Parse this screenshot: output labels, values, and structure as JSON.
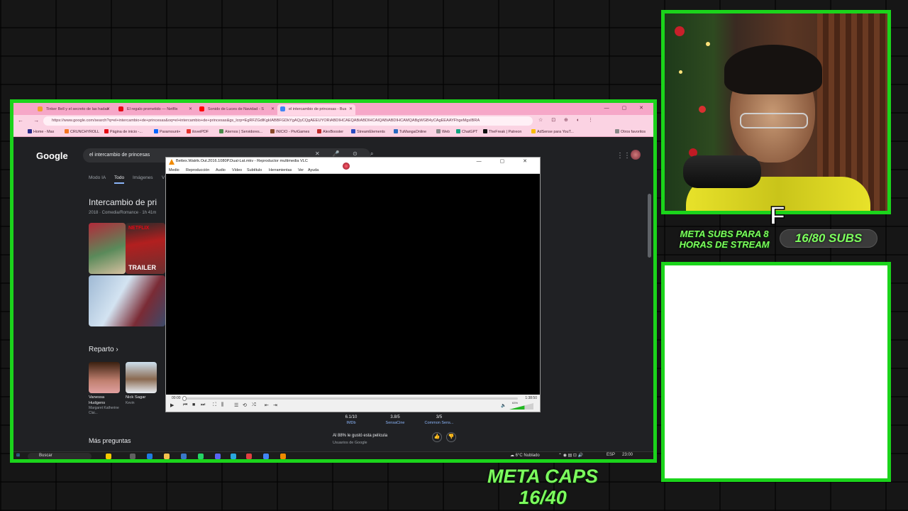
{
  "browser": {
    "tabs": [
      {
        "label": "Tinker Bell y el secreto de las hadas",
        "color": "#f0a030"
      },
      {
        "label": "El regalo prometido — Netflix",
        "color": "#e50914"
      },
      {
        "label": "Sonido de Luces de Navidad - S",
        "color": "#ff0000"
      },
      {
        "label": "el intercambio de princesas - Bus",
        "color": "#4285f4"
      }
    ],
    "url": "https://www.google.com/search?q=el+intercambio+de+princesas&oq=el+intercambio+de+princesas&gs_lcrp=EgRFZGdlKgkIABBFGDkYgAQyCQgAEEUYORiABDIHCAEQABiABDIHCAIQABiABDIHCAMQABgWGB4yCAgEEAAYFhgeMgsIBRA",
    "bookmarks": [
      {
        "label": "Home - Max",
        "color": "#2a2a8a"
      },
      {
        "label": "CRUNCHYROLL",
        "color": "#f47521"
      },
      {
        "label": "Página de inicio -...",
        "color": "#e50914"
      },
      {
        "label": "Paramount+",
        "color": "#0064ff"
      },
      {
        "label": "iloveiPDF",
        "color": "#e5322d"
      },
      {
        "label": "Aternos | Servidores...",
        "color": "#4a8a4a"
      },
      {
        "label": "INICIO - PiviGames",
        "color": "#8a4a2a"
      },
      {
        "label": "AlexBooster",
        "color": "#c02a2a"
      },
      {
        "label": "StreamElements",
        "color": "#2a4ac0"
      },
      {
        "label": "TuMangaOnline",
        "color": "#2a6ac0"
      },
      {
        "label": "Web",
        "color": "#888888"
      },
      {
        "label": "ChatGPT",
        "color": "#10a37f"
      },
      {
        "label": "TheFreak | Patreon",
        "color": "#111111"
      },
      {
        "label": "AdSense para YouT...",
        "color": "#fbbc04"
      },
      {
        "label": "Otros favoritos",
        "color": "#888888"
      }
    ]
  },
  "google": {
    "logo": "Google",
    "query": "el intercambio de princesas",
    "tabs": [
      "Modo IA",
      "Todo",
      "Imágenes",
      "V"
    ],
    "result_title": "Intercambio de pri",
    "result_meta": "2018 · Comedia/Romance · 1h 41m",
    "poster_labels": {
      "netflix": "NETFLIX",
      "trailer": "TRAILER"
    },
    "cast_heading": "Reparto",
    "cast": [
      {
        "name": "Vanessa Hudgens",
        "role": "Margaret Katherine Clai..."
      },
      {
        "name": "Nick Sagar",
        "role": "Kevin"
      }
    ],
    "ratings": [
      {
        "value": "6.1/10",
        "source": "IMDb"
      },
      {
        "value": "3.8/5",
        "source": "SensaCine"
      },
      {
        "value": "3/5",
        "source": "Common Sens..."
      }
    ],
    "liked": "Al 88% le gustó esta película",
    "users": "Usuarios de Google",
    "more_questions": "Más preguntas"
  },
  "vlc": {
    "title": "Bettex.Watrik.Out.2016.1080P.Dual-Lat.mkv - Reproductor multimedia VLC",
    "menu": [
      "Medio",
      "Reproducción",
      "Audio",
      "Vídeo",
      "Subtítulo",
      "Herramientas",
      "Ver",
      "Ayuda"
    ],
    "time_current": "00:00",
    "time_total": "1:38:50",
    "progress": 0.0,
    "volume": "63%"
  },
  "taskbar": {
    "search": "Buscar",
    "weather": "6°C Nublado",
    "lang": "ESP",
    "time": "23:00"
  },
  "overlay": {
    "letter": "F",
    "subs_goal": "META SUBS PARA 8 HORAS DE STREAM",
    "subs_count": "16/80 SUBS",
    "caps_goal_line1": "META CAPS",
    "caps_goal_line2": "16/40",
    "accent": "#1bd41b",
    "text_green": "#7dff5e"
  }
}
